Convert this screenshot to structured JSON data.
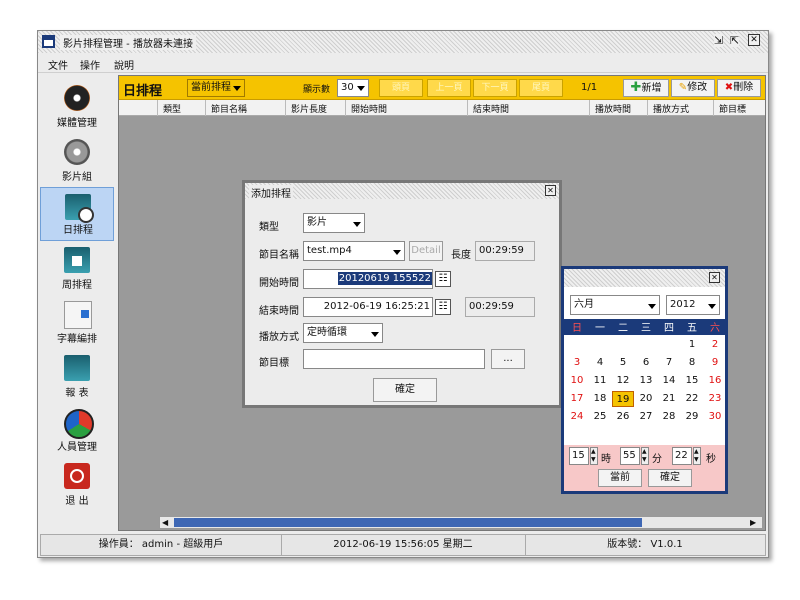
{
  "window": {
    "title": "影片排程管理 - 播放器未連接"
  },
  "menu": [
    "文件",
    "操作",
    "說明"
  ],
  "sidebar": {
    "items": [
      {
        "label": "媒體管理",
        "icon": "media-disc-icon"
      },
      {
        "label": "影片組",
        "icon": "film-group-icon"
      },
      {
        "label": "日排程",
        "icon": "daily-schedule-icon",
        "active": true
      },
      {
        "label": "周排程",
        "icon": "weekly-schedule-icon"
      },
      {
        "label": "字幕編排",
        "icon": "subtitle-icon"
      },
      {
        "label": "報 表",
        "icon": "report-icon"
      },
      {
        "label": "人員管理",
        "icon": "user-management-icon"
      },
      {
        "label": "退 出",
        "icon": "exit-icon"
      }
    ]
  },
  "toolbar": {
    "title": "日排程",
    "filter": "當前排程",
    "display_count_label": "顯示數",
    "display_count": "30",
    "first_page": "頭頁",
    "prev_page": "上一頁",
    "next_page": "下一頁",
    "last_page": "尾頁",
    "page_indicator": "1/1",
    "add": "新增",
    "edit": "修改",
    "delete": "刪除"
  },
  "table": {
    "columns": [
      "類型",
      "節目名稱",
      "影片長度",
      "開始時間",
      "結束時間",
      "播放時間",
      "播放方式",
      "節目標"
    ]
  },
  "dialog": {
    "title": "添加排程",
    "type_label": "類型",
    "type_value": "影片",
    "program_label": "節目名稱",
    "program_value": "test.mp4",
    "detail_button": "Detail",
    "length_label": "長度",
    "length_value": "00:29:59",
    "start_label": "開始時間",
    "start_value": "20120619 155522",
    "end_label": "結束時間",
    "end_value": "2012-06-19 16:25:21",
    "end_duration": "00:29:59",
    "mode_label": "播放方式",
    "mode_value": "定時循環",
    "target_label": "節目標",
    "target_value": "",
    "browse_button": "...",
    "confirm_button": "確定"
  },
  "calendar": {
    "month": "六月",
    "year": "2012",
    "weekdays": [
      "日",
      "一",
      "二",
      "三",
      "四",
      "五",
      "六"
    ],
    "weeks": [
      [
        "",
        "",
        "",
        "",
        "",
        "1",
        "2"
      ],
      [
        "3",
        "4",
        "5",
        "6",
        "7",
        "8",
        "9"
      ],
      [
        "10",
        "11",
        "12",
        "13",
        "14",
        "15",
        "16"
      ],
      [
        "17",
        "18",
        "19",
        "20",
        "21",
        "22",
        "23"
      ],
      [
        "24",
        "25",
        "26",
        "27",
        "28",
        "29",
        "30"
      ]
    ],
    "selected_day": "19",
    "hour": "15",
    "hour_label": "時",
    "minute": "55",
    "minute_label": "分",
    "second": "22",
    "second_label": "秒",
    "now_button": "當前",
    "ok_button": "確定"
  },
  "status": {
    "operator": "操作員： admin - 超級用戶",
    "datetime": "2012-06-19 15:56:05 星期二",
    "version": "版本號： V1.0.1"
  },
  "colors": {
    "toolbar": "#f5c300",
    "active_nav": "#bcd5f4",
    "calendar_border": "#1b3a7a",
    "selected_day": "#f5c300",
    "weekend": "#e01010"
  }
}
